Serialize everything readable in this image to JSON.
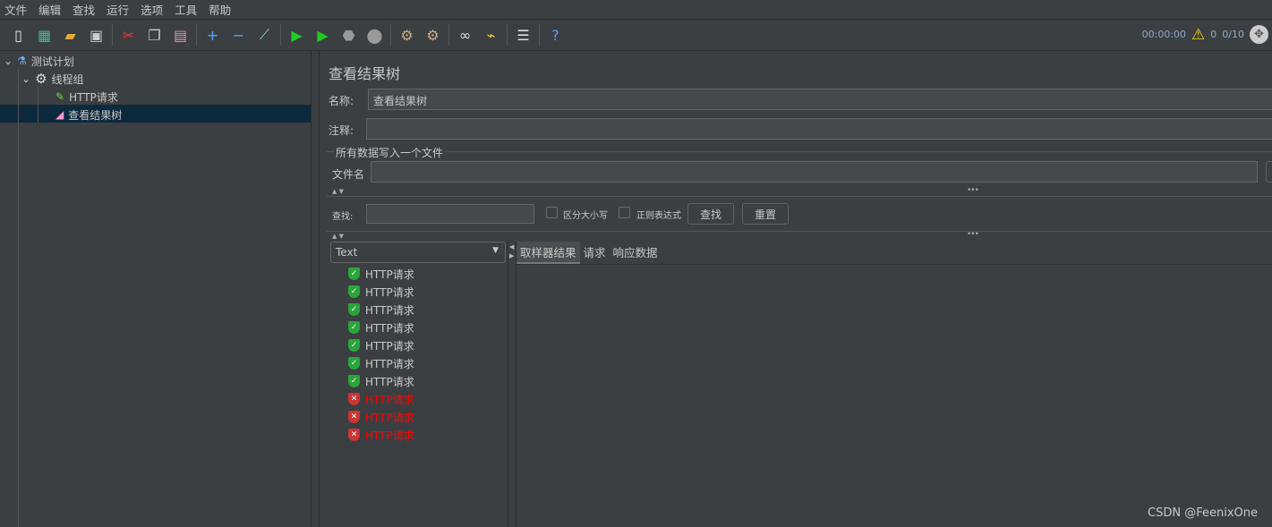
{
  "menu": [
    "文件",
    "编辑",
    "查找",
    "运行",
    "选项",
    "工具",
    "帮助"
  ],
  "toolbar": {
    "icons": [
      "new-icon",
      "templates-icon",
      "open-icon",
      "save-icon",
      "cut-icon",
      "copy-icon",
      "paste-icon",
      "expand-icon",
      "collapse-icon",
      "toggle-icon",
      "start-icon",
      "start-no-pause-icon",
      "stop-icon",
      "shutdown-icon",
      "clear-icon",
      "clear-all-icon",
      "search-icon",
      "reset-search-icon",
      "function-helper-icon",
      "help-icon"
    ]
  },
  "status": {
    "elapsed": "00:00:00",
    "warnings": "0",
    "threads": "0/10"
  },
  "tree": {
    "test_plan": "测试计划",
    "thread_group": "线程组",
    "http_request": "HTTP请求",
    "view_results": "查看结果树"
  },
  "panel": {
    "title": "查看结果树",
    "name_label": "名称:",
    "name_value": "查看结果树",
    "comment_label": "注释:",
    "comment_value": "",
    "file_section": "所有数据写入一个文件",
    "file_label": "文件名",
    "file_value": ""
  },
  "search": {
    "label": "查找:",
    "value": "",
    "case_sensitive": "区分大小写",
    "regex": "正则表达式",
    "find_button": "查找",
    "reset_button": "重置"
  },
  "renderer": {
    "selected": "Text"
  },
  "results": [
    {
      "label": "HTTP请求",
      "success": true
    },
    {
      "label": "HTTP请求",
      "success": true
    },
    {
      "label": "HTTP请求",
      "success": true
    },
    {
      "label": "HTTP请求",
      "success": true
    },
    {
      "label": "HTTP请求",
      "success": true
    },
    {
      "label": "HTTP请求",
      "success": true
    },
    {
      "label": "HTTP请求",
      "success": true
    },
    {
      "label": "HTTP请求",
      "success": false
    },
    {
      "label": "HTTP请求",
      "success": false
    },
    {
      "label": "HTTP请求",
      "success": false
    }
  ],
  "tabs": [
    "取样器结果",
    "请求",
    "响应数据"
  ],
  "watermark": "CSDN @FeenixOne",
  "colors": {
    "success": "#2aa53a",
    "failure": "#ff0000",
    "selection": "#0d293e"
  }
}
